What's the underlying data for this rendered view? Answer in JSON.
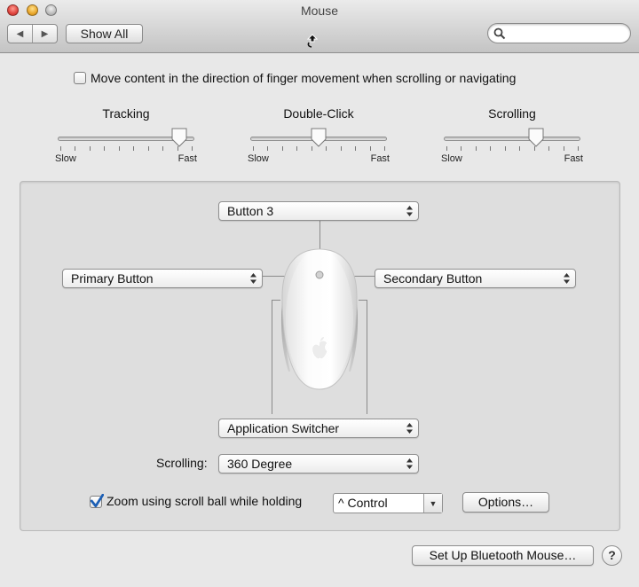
{
  "window": {
    "title": "Mouse",
    "show_all": "Show All",
    "search_placeholder": ""
  },
  "natural_scrolling": {
    "checked": false,
    "label": "Move content in the direction of finger movement when scrolling or navigating"
  },
  "sliders": [
    {
      "title": "Tracking",
      "low_label": "Slow",
      "high_label": "Fast",
      "level": 0.95
    },
    {
      "title": "Double-Click",
      "low_label": "Slow",
      "high_label": "Fast",
      "level": 0.5
    },
    {
      "title": "Scrolling",
      "low_label": "Slow",
      "high_label": "Fast",
      "level": 0.7
    }
  ],
  "buttons_config": {
    "top": "Button 3",
    "left": "Primary Button",
    "right": "Secondary Button",
    "side": "Application Switcher",
    "scrolling_label": "Scrolling:",
    "scrolling_value": "360 Degree"
  },
  "zoom": {
    "checked": true,
    "label": "Zoom using scroll ball while holding",
    "modifier": "^ Control",
    "options_button": "Options…"
  },
  "footer": {
    "setup_button": "Set Up Bluetooth Mouse…",
    "help": "?"
  },
  "icons": {
    "back": "back-arrow-icon",
    "forward": "forward-arrow-icon",
    "search": "magnifier-icon",
    "check": "checkmark-icon",
    "popup": "up-down-arrows-icon",
    "apple": "apple-logo-icon"
  },
  "colors": {
    "window_bg": "#e8e8e8",
    "group_bg": "#dedede",
    "check_blue": "#1c5fb5",
    "close": "#e0443e",
    "minimize": "#e9a72c"
  }
}
